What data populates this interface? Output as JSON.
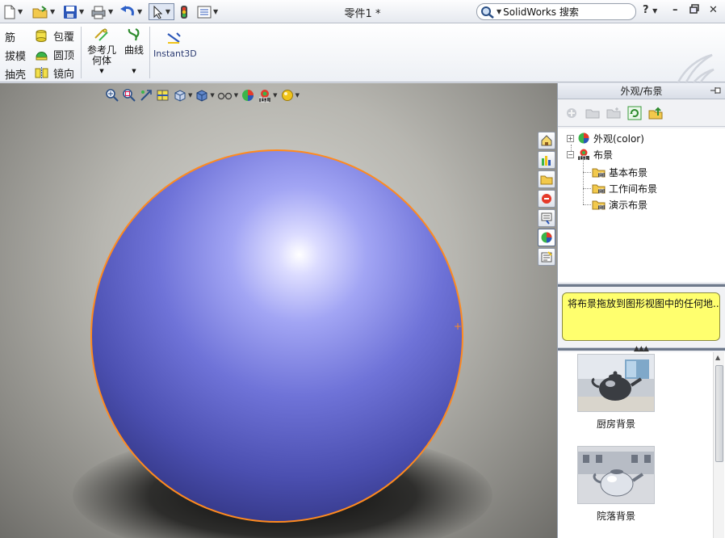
{
  "window": {
    "title": "零件1 *",
    "search_placeholder": "SolidWorks 搜索",
    "help_label": "?"
  },
  "command_manager": {
    "features": [
      {
        "label": "筋",
        "icon": "rib-icon"
      },
      {
        "label": "包覆",
        "icon": "wrap-icon"
      },
      {
        "label": "拔模",
        "icon": "draft-icon"
      },
      {
        "label": "圆顶",
        "icon": "dome-icon"
      },
      {
        "label": "抽壳",
        "icon": "shell-icon"
      },
      {
        "label": "镜向",
        "icon": "mirror-icon"
      }
    ],
    "reference_geometry_line1": "参考几",
    "reference_geometry_line2": "何体",
    "curves_label": "曲线",
    "instant3d_label": "Instant3D"
  },
  "task_pane": {
    "title": "外观/布景",
    "tree": [
      {
        "label": "外观(color)",
        "expander": "+",
        "icon": "appearance-icon"
      },
      {
        "label": "布景",
        "expander": "−",
        "icon": "scene-icon"
      },
      {
        "label": "基本布景",
        "icon": "folder-icon"
      },
      {
        "label": "工作间布景",
        "icon": "folder-icon"
      },
      {
        "label": "演示布景",
        "icon": "folder-icon"
      }
    ],
    "hint": "将布景拖放到图形视图中的任何地...",
    "gallery": [
      {
        "label": "厨房背景",
        "icon": "teapot-kitchen-thumbnail"
      },
      {
        "label": "院落背景",
        "icon": "teapot-courtyard-thumbnail"
      }
    ]
  },
  "colors": {
    "sphere": "#6f73d8",
    "selection_edge": "#ff8a1f",
    "hint_background": "#ffff6e"
  }
}
